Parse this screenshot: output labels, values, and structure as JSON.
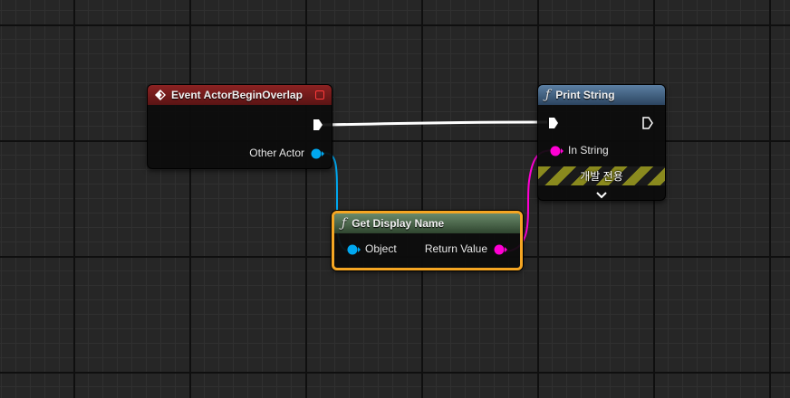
{
  "event_node": {
    "title": "Event ActorBeginOverlap",
    "header_color": "#7a1c1c",
    "output_pin_label": "Other Actor",
    "icons": [
      "event-diamond-icon",
      "delegate-square-icon",
      "exec-out-pin",
      "object-pin-blue"
    ]
  },
  "print_node": {
    "title": "Print String",
    "function_glyph": "ƒ",
    "header_color": "#4a6a8a",
    "input_pin_label": "In String",
    "dev_only_label": "개발 전용",
    "expand_icon": "chevron-down-icon"
  },
  "display_name_node": {
    "title": "Get Display Name",
    "function_glyph": "ƒ",
    "header_color": "#4f6b4f",
    "input_pin_label": "Object",
    "output_pin_label": "Return Value",
    "selection_color": "#f5a623"
  },
  "colors": {
    "exec_wire": "#ffffff",
    "object_pin": "#00a8f0",
    "string_pin": "#ff00d4",
    "background": "#262626"
  }
}
